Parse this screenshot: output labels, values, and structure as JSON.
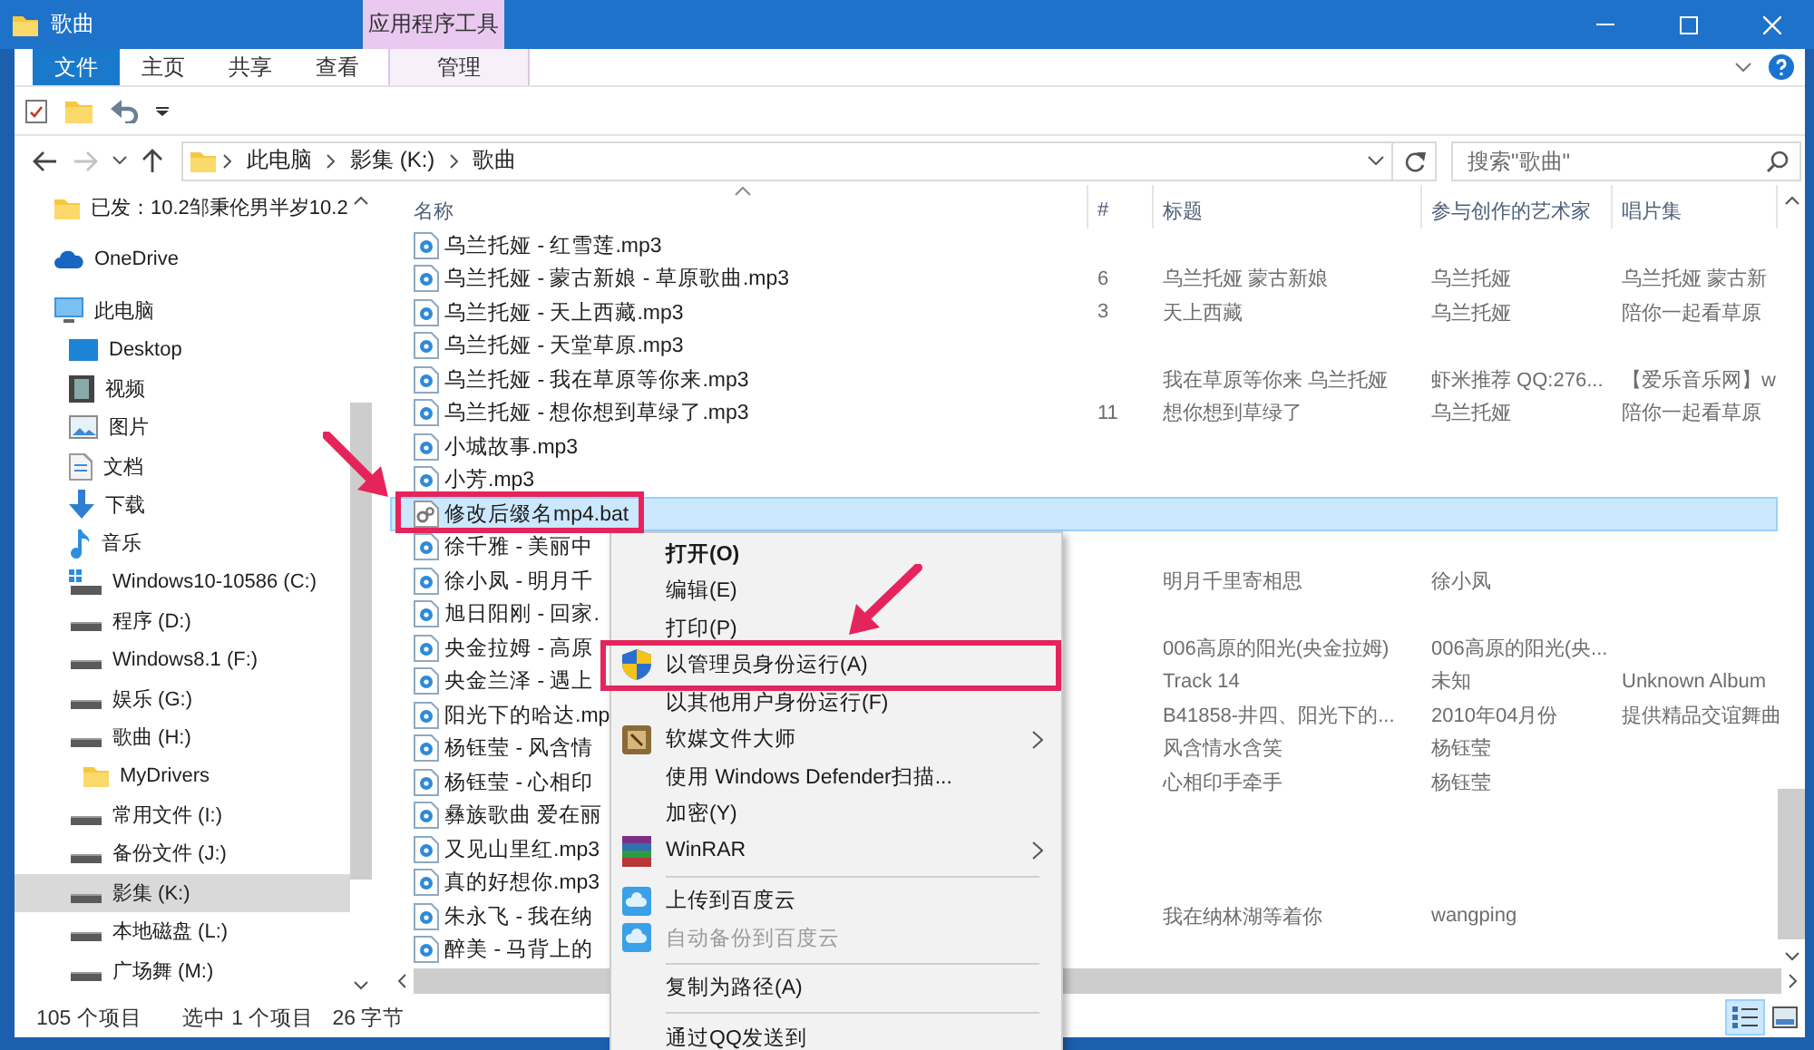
{
  "window": {
    "title": "歌曲",
    "context_group": "应用程序工具"
  },
  "ribbon_tabs": [
    {
      "label": "文件",
      "kind": "file"
    },
    {
      "label": "主页",
      "kind": "tab"
    },
    {
      "label": "共享",
      "kind": "tab"
    },
    {
      "label": "查看",
      "kind": "tab"
    },
    {
      "label": "管理",
      "kind": "context"
    }
  ],
  "address_bar": {
    "forward_disabled": true,
    "crumbs": [
      "此电脑",
      "影集 (K:)",
      "歌曲"
    ]
  },
  "search": {
    "placeholder": "搜索\"歌曲\""
  },
  "nav": [
    {
      "label": "已发：10.2邹秉伦男半岁10.2",
      "kind": "folder",
      "selected": false
    },
    {
      "label": "OneDrive",
      "kind": "cloud",
      "selected": false
    },
    {
      "label": "此电脑",
      "kind": "pc",
      "selected": false,
      "children": [
        {
          "label": "Desktop",
          "kind": "desktop",
          "selected": false
        },
        {
          "label": "视频",
          "kind": "video",
          "selected": false
        },
        {
          "label": "图片",
          "kind": "pictures",
          "selected": false
        },
        {
          "label": "文档",
          "kind": "documents",
          "selected": false
        },
        {
          "label": "下载",
          "kind": "downloads",
          "selected": false
        },
        {
          "label": "音乐",
          "kind": "music",
          "selected": false
        },
        {
          "label": "Windows10-10586 (C:)",
          "kind": "system-drive",
          "selected": false
        },
        {
          "label": "程序 (D:)",
          "kind": "drive",
          "selected": false
        },
        {
          "label": "Windows8.1 (F:)",
          "kind": "drive",
          "selected": false
        },
        {
          "label": "娱乐 (G:)",
          "kind": "drive",
          "selected": false
        },
        {
          "label": "歌曲 (H:)",
          "kind": "drive",
          "selected": false,
          "children": [
            {
              "label": "MyDrivers",
              "kind": "folder",
              "selected": false
            }
          ]
        },
        {
          "label": "常用文件 (I:)",
          "kind": "drive",
          "selected": false
        },
        {
          "label": "备份文件  (J:)",
          "kind": "drive",
          "selected": false
        },
        {
          "label": "影集 (K:)",
          "kind": "drive",
          "selected": true
        },
        {
          "label": "本地磁盘 (L:)",
          "kind": "drive",
          "selected": false
        },
        {
          "label": "广场舞 (M:)",
          "kind": "drive",
          "selected": false
        }
      ]
    }
  ],
  "table": {
    "columns": [
      "名称",
      "#",
      "标题",
      "参与创作的艺术家",
      "唱片集"
    ],
    "rows": [
      {
        "name": "乌兰托娅 - 红雪莲.mp3",
        "kind": "audio",
        "selected": false,
        "highlighted": false
      },
      {
        "name": "乌兰托娅 - 蒙古新娘 - 草原歌曲.mp3",
        "number": "6",
        "title": "乌兰托娅 蒙古新娘",
        "artist": "乌兰托娅",
        "album": "乌兰托娅 蒙古新",
        "kind": "audio",
        "selected": false,
        "highlighted": false
      },
      {
        "name": "乌兰托娅 - 天上西藏.mp3",
        "number": "3",
        "title": "天上西藏",
        "artist": "乌兰托娅",
        "album": "陪你一起看草原",
        "kind": "audio",
        "selected": false,
        "highlighted": false
      },
      {
        "name": "乌兰托娅 - 天堂草原.mp3",
        "kind": "audio",
        "selected": false,
        "highlighted": false
      },
      {
        "name": "乌兰托娅 - 我在草原等你来.mp3",
        "title": "我在草原等你来 乌兰托娅",
        "artist": "虾米推荐 QQ:276...",
        "album": "【爱乐音乐网】w",
        "kind": "audio",
        "selected": false,
        "highlighted": false
      },
      {
        "name": "乌兰托娅 - 想你想到草绿了.mp3",
        "number": "11",
        "title": "想你想到草绿了",
        "artist": "乌兰托娅",
        "album": "陪你一起看草原",
        "kind": "audio",
        "selected": false,
        "highlighted": false
      },
      {
        "name": "小城故事.mp3",
        "kind": "audio",
        "selected": false,
        "highlighted": false
      },
      {
        "name": "小芳.mp3",
        "kind": "audio",
        "selected": false,
        "highlighted": false
      },
      {
        "name": "修改后缀名mp4.bat",
        "kind": "script",
        "selected": true,
        "highlighted": true
      },
      {
        "name": "徐千雅 - 美丽中",
        "kind": "audio",
        "selected": false,
        "highlighted": false
      },
      {
        "name": "徐小凤 - 明月千",
        "title": "明月千里寄相思",
        "artist": "徐小凤",
        "kind": "audio",
        "selected": false,
        "highlighted": false
      },
      {
        "name": "旭日阳刚 - 回家.",
        "kind": "audio",
        "selected": false,
        "highlighted": false
      },
      {
        "name": "央金拉姆 - 高原",
        "title": "006高原的阳光(央金拉姆)",
        "artist": "006高原的阳光(央...",
        "kind": "audio",
        "selected": false,
        "highlighted": false
      },
      {
        "name": "央金兰泽 - 遇上",
        "title": "Track 14",
        "artist": "未知",
        "album": "Unknown Album",
        "kind": "audio",
        "selected": false,
        "highlighted": false
      },
      {
        "name": "阳光下的哈达.mp",
        "title": "B41858-井四、阳光下的...",
        "artist": "2010年04月份",
        "album": "提供精品交谊舞曲",
        "kind": "audio",
        "selected": false,
        "highlighted": false
      },
      {
        "name": "杨钰莹 - 风含情",
        "title": "风含情水含笑",
        "artist": "杨钰莹",
        "kind": "audio",
        "selected": false,
        "highlighted": false
      },
      {
        "name": "杨钰莹 - 心相印",
        "title": "心相印手牵手",
        "artist": "杨钰莹",
        "kind": "audio",
        "selected": false,
        "highlighted": false
      },
      {
        "name": "彝族歌曲 爱在丽",
        "kind": "audio",
        "selected": false,
        "highlighted": false
      },
      {
        "name": "又见山里红.mp3",
        "kind": "audio",
        "selected": false,
        "highlighted": false
      },
      {
        "name": "真的好想你.mp3",
        "kind": "audio",
        "selected": false,
        "highlighted": false
      },
      {
        "name": "朱永飞 - 我在纳",
        "title": "我在纳林湖等着你",
        "artist": "wangping",
        "kind": "audio",
        "selected": false,
        "highlighted": false
      },
      {
        "name": "醉美 - 马背上的",
        "kind": "audio",
        "selected": false,
        "highlighted": false
      }
    ]
  },
  "context_menu": [
    {
      "label": "打开(O)",
      "kind": "plain",
      "default": true,
      "disabled": false,
      "submenu": false,
      "highlighted": false
    },
    {
      "label": "编辑(E)",
      "kind": "plain",
      "default": false,
      "disabled": false,
      "submenu": false,
      "highlighted": false
    },
    {
      "label": "打印(P)",
      "kind": "plain",
      "default": false,
      "disabled": false,
      "submenu": false,
      "highlighted": false
    },
    {
      "label": "以管理员身份运行(A)",
      "kind": "shield",
      "default": false,
      "disabled": false,
      "submenu": false,
      "highlighted": true
    },
    {
      "label": "以其他用户身份运行(F)",
      "kind": "plain",
      "default": false,
      "disabled": false,
      "submenu": false,
      "highlighted": false
    },
    {
      "label": "软媒文件大师",
      "kind": "app",
      "default": false,
      "disabled": false,
      "submenu": true,
      "highlighted": false
    },
    {
      "label": "使用 Windows Defender扫描...",
      "kind": "plain",
      "default": false,
      "disabled": false,
      "submenu": false,
      "highlighted": false
    },
    {
      "label": "加密(Y)",
      "kind": "plain",
      "default": false,
      "disabled": false,
      "submenu": false,
      "highlighted": false
    },
    {
      "label": "WinRAR",
      "kind": "archive",
      "default": false,
      "disabled": false,
      "submenu": true,
      "highlighted": false
    },
    {
      "kind": "separator"
    },
    {
      "label": "上传到百度云",
      "kind": "cloud",
      "default": false,
      "disabled": false,
      "submenu": false,
      "highlighted": false
    },
    {
      "label": "自动备份到百度云",
      "kind": "cloud",
      "default": false,
      "disabled": true,
      "submenu": false,
      "highlighted": false
    },
    {
      "kind": "separator"
    },
    {
      "label": "复制为路径(A)",
      "kind": "plain",
      "default": false,
      "disabled": false,
      "submenu": false,
      "highlighted": false
    },
    {
      "kind": "separator"
    },
    {
      "label": "通过QQ发送到",
      "kind": "plain",
      "default": false,
      "disabled": false,
      "submenu": false,
      "highlighted": false
    }
  ],
  "status_bar": {
    "item_count": "105 个项目",
    "selection": "选中 1 个项目",
    "size": "26 字节",
    "views": [
      {
        "kind": "details",
        "selected": true
      },
      {
        "kind": "thumbnails",
        "selected": false
      }
    ]
  }
}
